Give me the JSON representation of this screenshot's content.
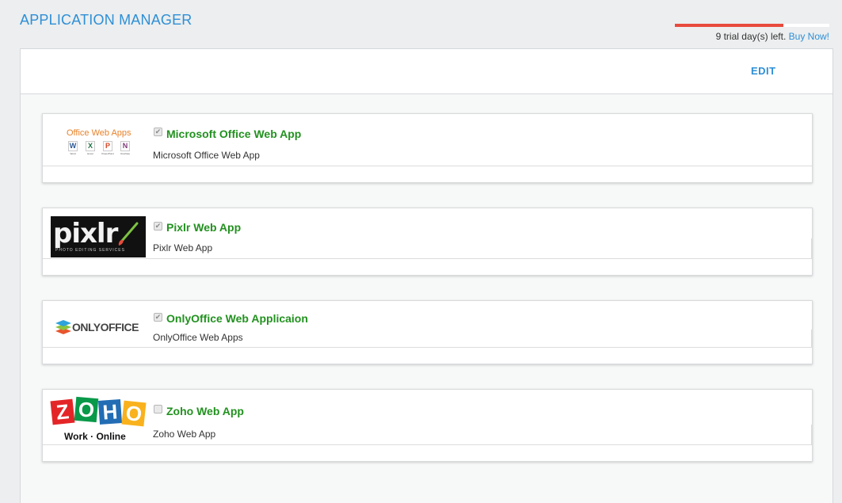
{
  "header": {
    "title": "APPLICATION MANAGER"
  },
  "trial": {
    "progress_fraction": 0.7,
    "text": "9 trial day(s) left.",
    "buy_label": "Buy Now!"
  },
  "toolbar": {
    "edit_label": "EDIT"
  },
  "apps": [
    {
      "name": "Microsoft Office Web App",
      "description": "Microsoft Office Web App",
      "checked": true,
      "logo": {
        "heading": "Office Web Apps",
        "icons": [
          "W",
          "X",
          "P",
          "N"
        ],
        "icon_labels": [
          "Word",
          "Excel",
          "PowerPoint",
          "OneNote"
        ],
        "icon_colors": [
          "#2b5797",
          "#1e7145",
          "#d24726",
          "#80397b"
        ]
      }
    },
    {
      "name": "Pixlr Web App",
      "description": "Pixlr Web App",
      "checked": true,
      "logo": {
        "wordmark": "pixlr",
        "tagline": "PHOTO EDITING SERVICES",
        "icon": "paintbrush-icon"
      }
    },
    {
      "name": "OnlyOffice Web Applicaion",
      "description": "OnlyOffice Web Apps",
      "checked": true,
      "logo": {
        "wordmark": "ONLYOFFICE",
        "icon": "stacked-layers-icon"
      }
    },
    {
      "name": "Zoho Web App",
      "description": "Zoho Web App",
      "checked": false,
      "logo": {
        "letters": [
          "Z",
          "O",
          "H",
          "O"
        ],
        "letter_colors": [
          "#e42527",
          "#089949",
          "#226db4",
          "#f9b21d"
        ],
        "tagline": "Work · Online"
      }
    }
  ],
  "colors": {
    "accent": "#2e8fd6",
    "app_title": "#22911f",
    "trial_bar": "#e84b3c"
  }
}
